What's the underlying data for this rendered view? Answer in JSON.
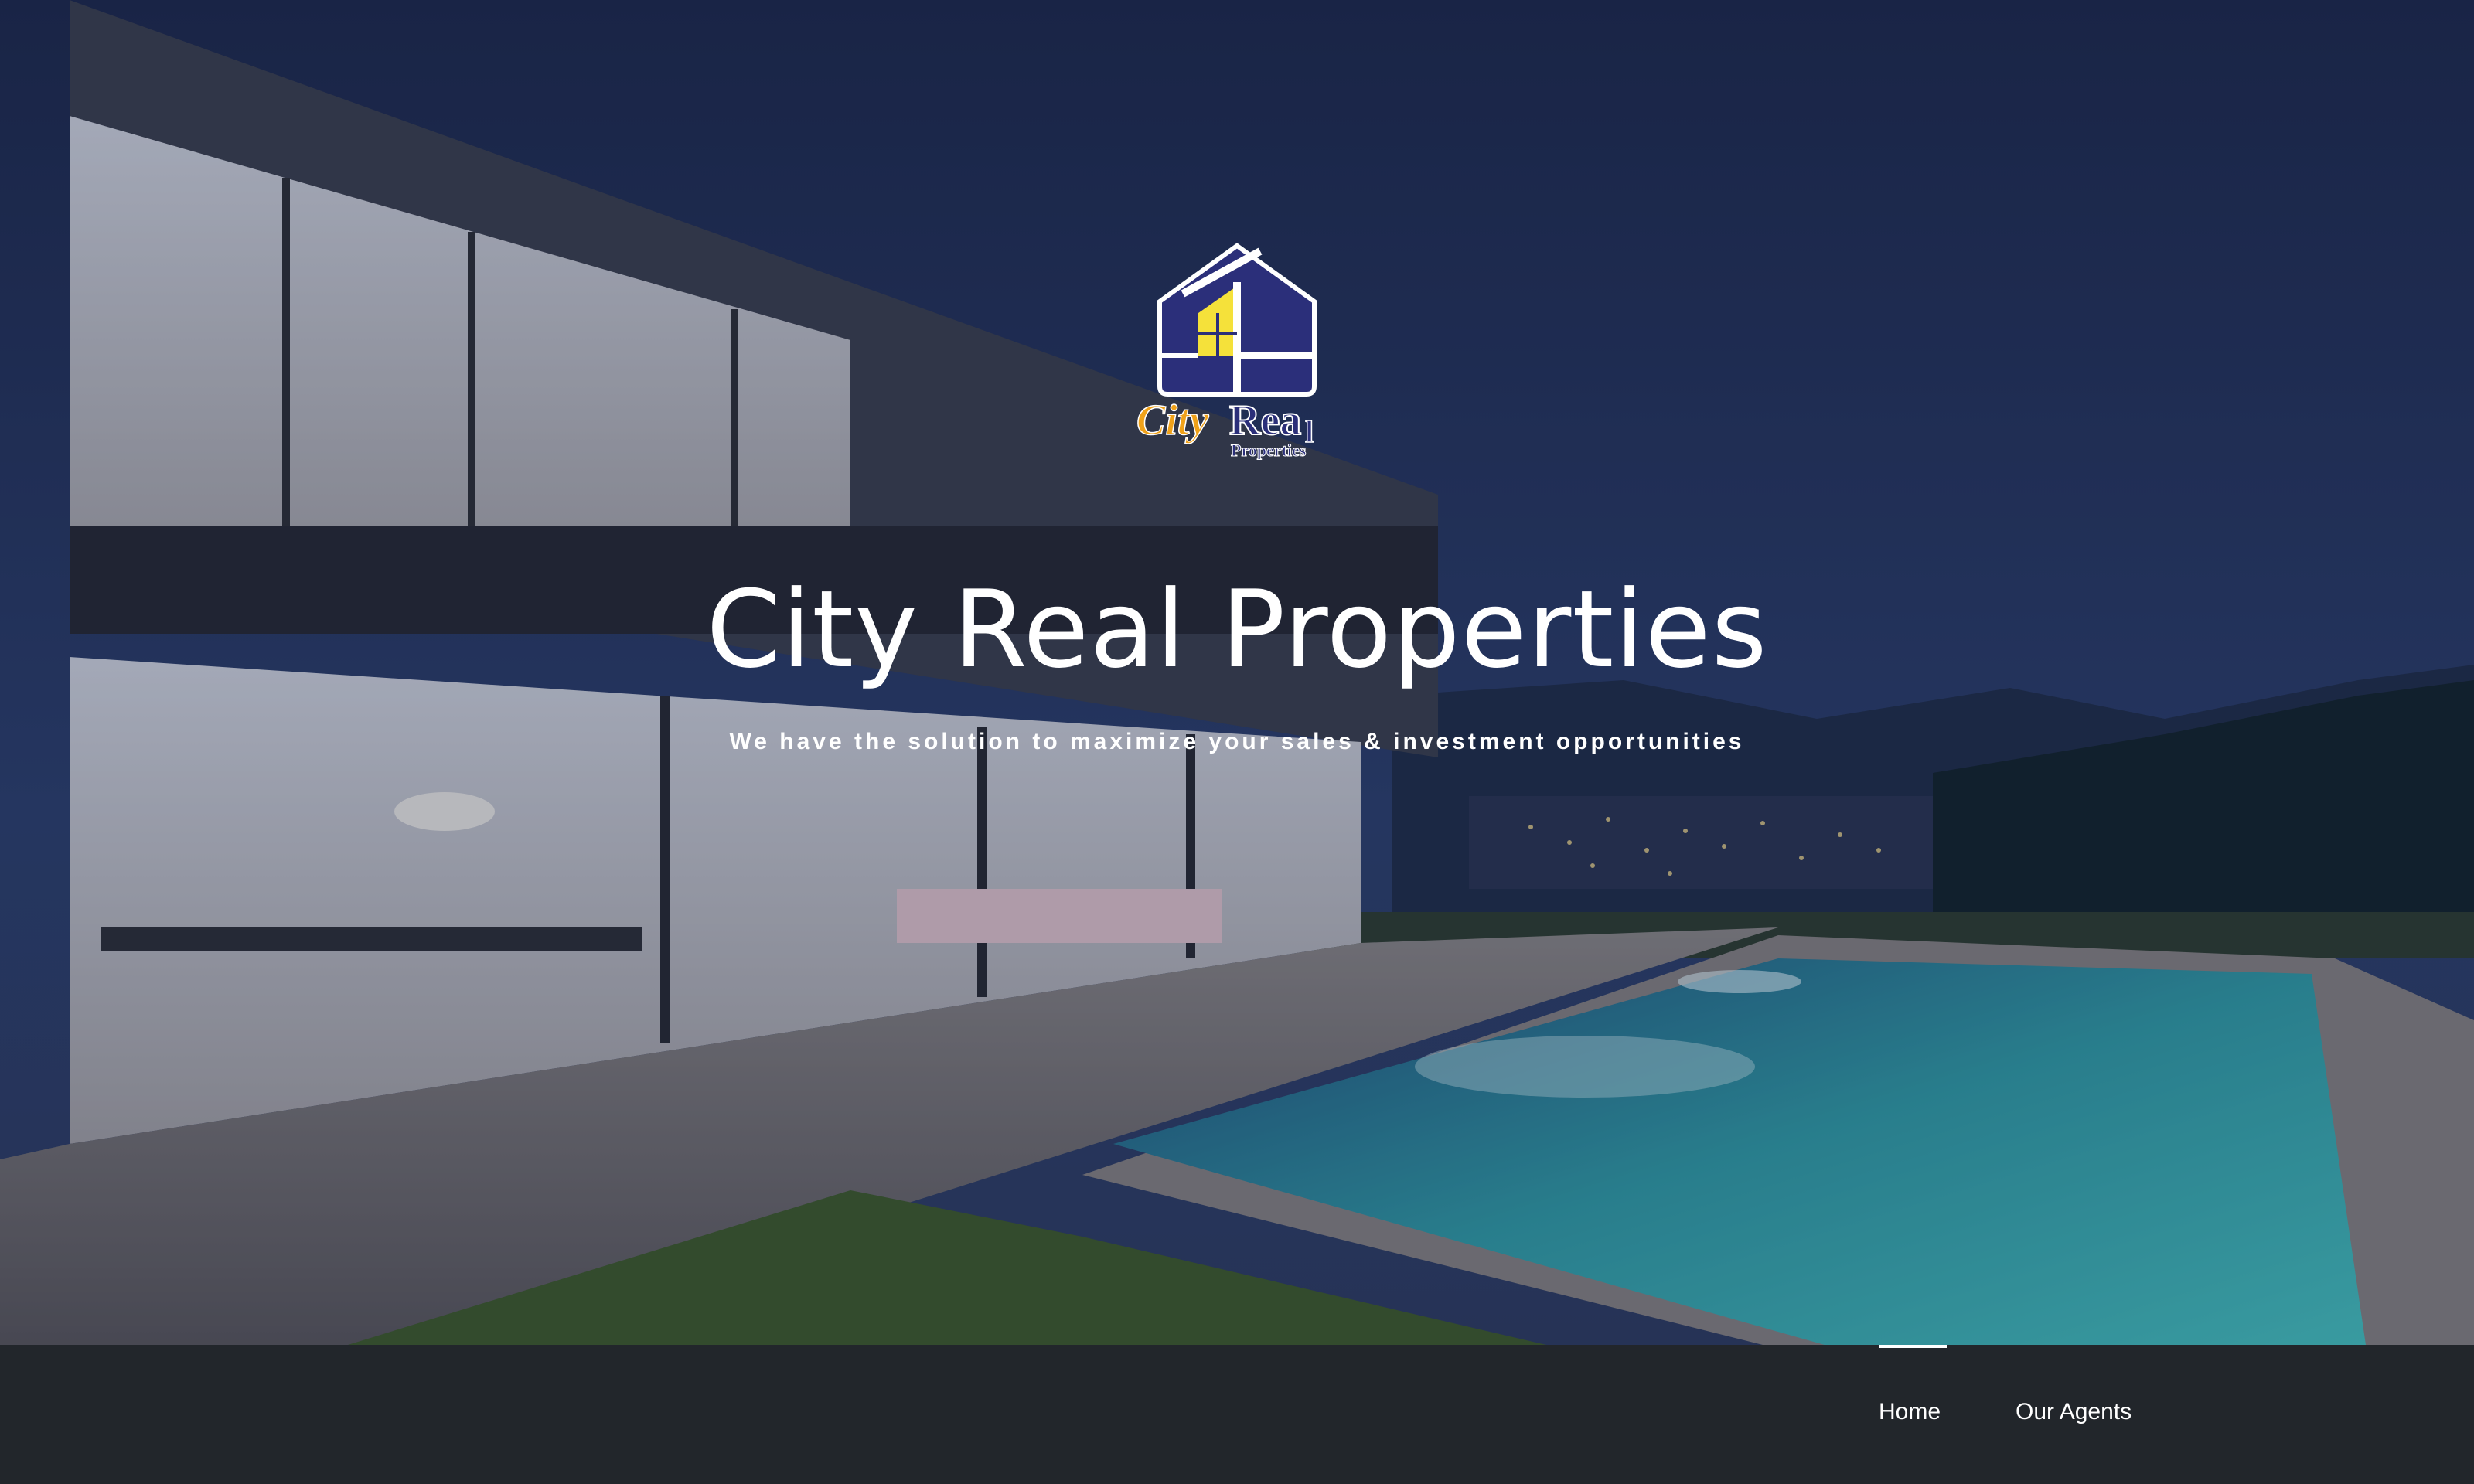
{
  "brand": {
    "logo_text_city": "City",
    "logo_text_real": "Real",
    "logo_text_properties": "Properties",
    "colors": {
      "navy": "#2b2f7a",
      "yellow": "#f5e13a",
      "orange": "#f0a21a",
      "nav_bg": "#22262b"
    }
  },
  "hero": {
    "title": "City Real Properties",
    "subtitle": "We have the solution to maximize your sales & investment opportunities"
  },
  "nav": {
    "items": [
      {
        "label": "Home",
        "active": true
      },
      {
        "label": "Our Agents",
        "active": false
      }
    ]
  }
}
